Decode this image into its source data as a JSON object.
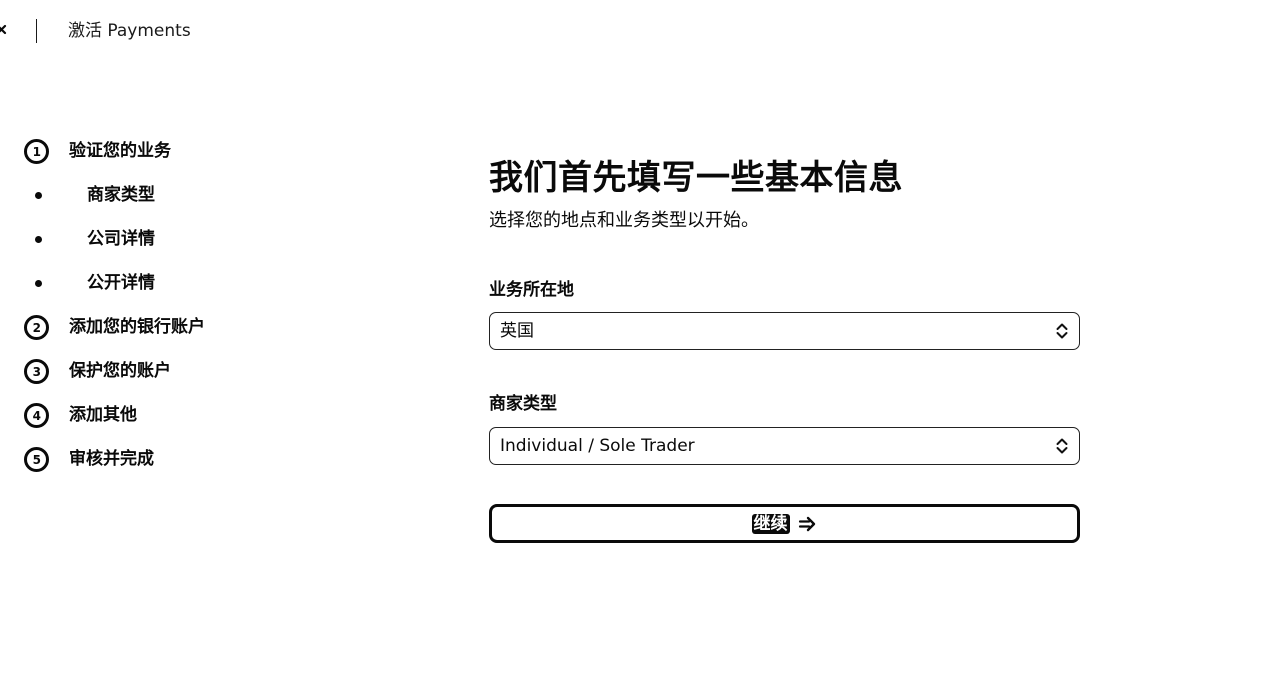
{
  "header": {
    "close_icon": "close-icon",
    "title": "激活 Payments"
  },
  "steps": [
    {
      "number": "1",
      "label": "验证您的业务",
      "substeps": [
        "商家类型",
        "公司详情",
        "公开详情"
      ]
    },
    {
      "number": "2",
      "label": "添加您的银行账户"
    },
    {
      "number": "3",
      "label": "保护您的账户"
    },
    {
      "number": "4",
      "label": "添加其他"
    },
    {
      "number": "5",
      "label": "审核并完成"
    }
  ],
  "main": {
    "title": "我们首先填写一些基本信息",
    "subtitle": "选择您的地点和业务类型以开始。",
    "location": {
      "label": "业务所在地",
      "value": "英国",
      "icon": "chevron-up-down-icon"
    },
    "merchant_type": {
      "label": "商家类型",
      "value": "Individual / Sole Trader",
      "icon": "chevron-up-down-icon"
    },
    "continue_button": {
      "label": "继续",
      "icon": "arrow-right-icon"
    }
  }
}
